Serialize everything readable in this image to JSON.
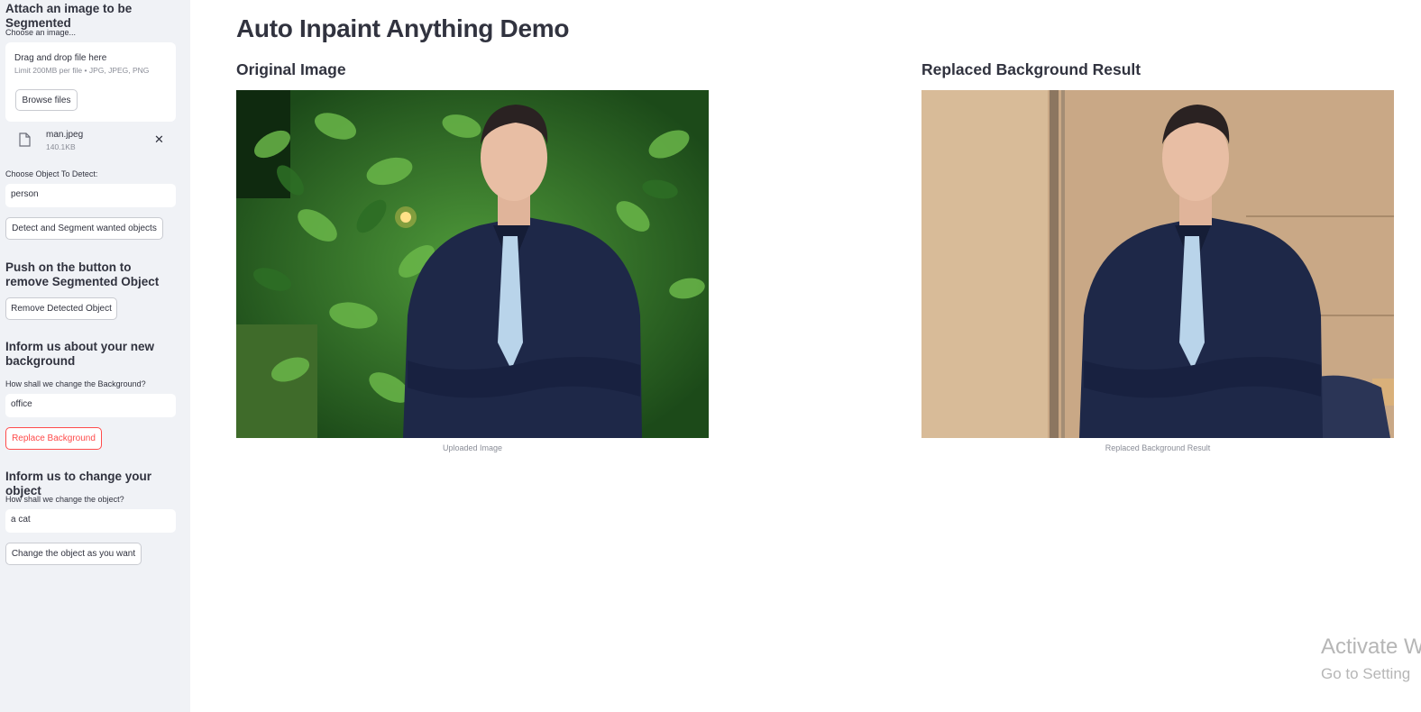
{
  "sidebar": {
    "upload_heading": "Attach an image to be Segmented",
    "upload_label": "Choose an image...",
    "drop_text": "Drag and drop file here",
    "limit_text": "Limit 200MB per file • JPG, JPEG, PNG",
    "browse_label": "Browse files",
    "file": {
      "name": "man.jpeg",
      "size": "140.1KB",
      "icon": "file-icon",
      "remove_icon": "close-icon"
    },
    "detect_label": "Choose Object To Detect:",
    "detect_value": "person",
    "detect_button": "Detect and Segment wanted objects",
    "remove_heading": "Push on the button to remove Segmented Object",
    "remove_button": "Remove Detected Object",
    "background_heading": "Inform us about your new background",
    "background_label": "How shall we change the Background?",
    "background_value": "office",
    "replace_button": "Replace Background",
    "object_heading": "Inform us to change your object",
    "object_label": "How shall we change the object?",
    "object_value": "a cat",
    "change_button": "Change the object as you want"
  },
  "main": {
    "title": "Auto Inpaint Anything Demo",
    "original": {
      "heading": "Original Image",
      "caption": "Uploaded Image"
    },
    "result": {
      "heading": "Replaced Background Result",
      "caption": "Replaced Background Result"
    }
  },
  "watermark": {
    "line1": "Activate W",
    "line2": "Go to Setting"
  },
  "colors": {
    "sidebar_bg": "#f0f2f6",
    "accent_red": "#ff4b4b",
    "text": "#31333f",
    "muted": "#8a8d97"
  }
}
